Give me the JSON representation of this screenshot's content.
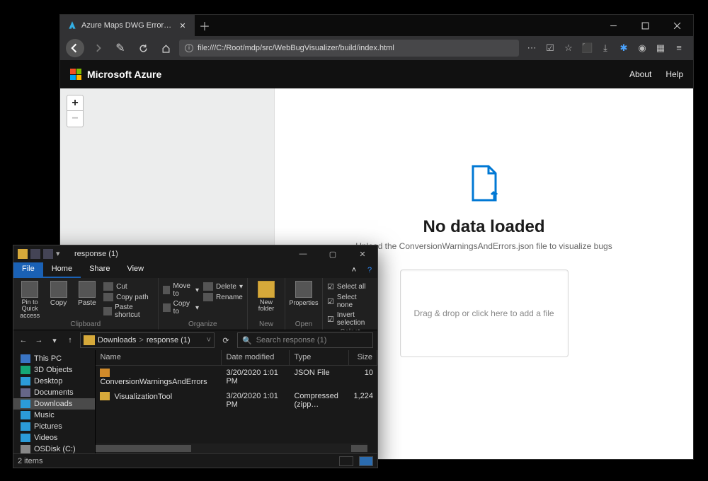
{
  "browser": {
    "tab_title": "Azure Maps DWG Errors Visual…",
    "url": "file:///C:/Root/mdp/src/WebBugVisualizer/build/index.html",
    "window": {
      "min": "min",
      "max": "max",
      "close": "close"
    }
  },
  "azure": {
    "brand": "Microsoft Azure",
    "links": {
      "about": "About",
      "help": "Help"
    }
  },
  "map": {
    "plus": "+",
    "minus": "−"
  },
  "main": {
    "heading": "No data loaded",
    "sub": "Upload the ConversionWarningsAndErrors.json file to visualize bugs",
    "dropzone": "Drag & drop or click here to add a file"
  },
  "explorer": {
    "title": "response (1)",
    "tabs": {
      "file": "File",
      "home": "Home",
      "share": "Share",
      "view": "View"
    },
    "ribbon": {
      "clipboard": {
        "pin": "Pin to Quick access",
        "copy": "Copy",
        "paste": "Paste",
        "cut": "Cut",
        "copypath": "Copy path",
        "shortcut": "Paste shortcut",
        "group": "Clipboard"
      },
      "organize": {
        "moveto": "Move to",
        "copyto": "Copy to",
        "delete": "Delete",
        "rename": "Rename",
        "group": "Organize"
      },
      "newg": {
        "newfolder": "New folder",
        "group": "New"
      },
      "open": {
        "properties": "Properties",
        "group": "Open"
      },
      "select": {
        "all": "Select all",
        "none": "Select none",
        "invert": "Invert selection",
        "group": "Select"
      }
    },
    "breadcrumbs": [
      "Downloads",
      ">",
      "response (1)"
    ],
    "search_placeholder": "Search response (1)",
    "columns": {
      "name": "Name",
      "date": "Date modified",
      "type": "Type",
      "size": "Size"
    },
    "tree": [
      "This PC",
      "3D Objects",
      "Desktop",
      "Documents",
      "Downloads",
      "Music",
      "Pictures",
      "Videos",
      "OSDisk (C:)"
    ],
    "rows": [
      {
        "icon": "icn-json",
        "name": "ConversionWarningsAndErrors",
        "date": "3/20/2020 1:01 PM",
        "type": "JSON File",
        "size": "10"
      },
      {
        "icon": "icn-zip",
        "name": "VisualizationTool",
        "date": "3/20/2020 1:01 PM",
        "type": "Compressed (zipp…",
        "size": "1,224"
      }
    ],
    "status": "2 items"
  }
}
